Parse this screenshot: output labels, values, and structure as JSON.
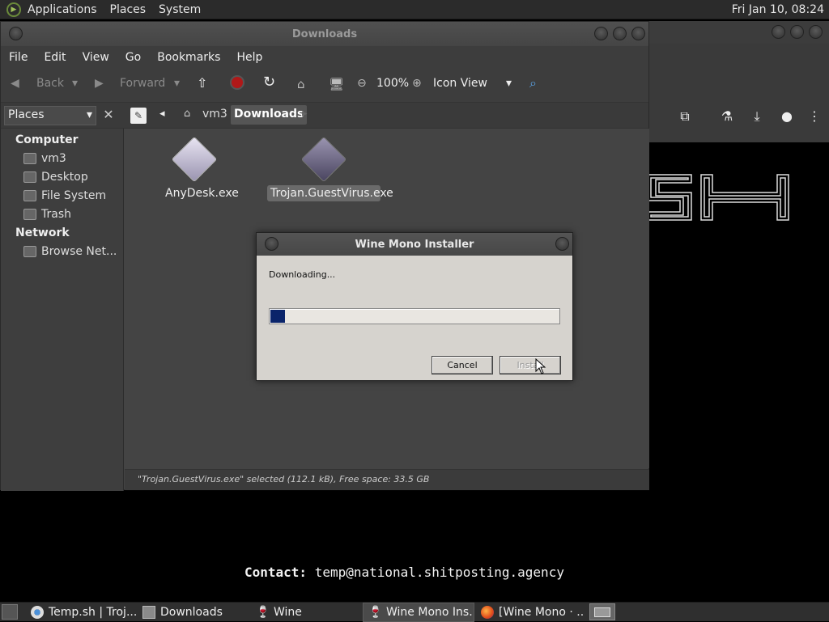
{
  "top_panel": {
    "menus": [
      "Applications",
      "Places",
      "System"
    ],
    "clock": "Fri Jan 10, 08:24"
  },
  "browser": {
    "contact_label": "Contact:",
    "contact_value": "temp@national.shitposting.agency"
  },
  "file_manager": {
    "title": "Downloads",
    "menu": [
      "File",
      "Edit",
      "View",
      "Go",
      "Bookmarks",
      "Help"
    ],
    "toolbar": {
      "back": "Back",
      "forward": "Forward",
      "zoom": "100%",
      "view_mode": "Icon View"
    },
    "location": {
      "crumbs": [
        "vm3",
        "Downloads"
      ]
    },
    "sidebar": {
      "combo": "Places",
      "sections": [
        {
          "title": "Computer",
          "items": [
            "vm3",
            "Desktop",
            "File System",
            "Trash"
          ]
        },
        {
          "title": "Network",
          "items": [
            "Browse Net..."
          ]
        }
      ]
    },
    "files": [
      {
        "name": "AnyDesk.exe",
        "selected": false
      },
      {
        "name": "Trojan.GuestVirus.exe",
        "selected": true
      }
    ],
    "status": "\"Trojan.GuestVirus.exe\" selected (112.1 kB), Free space: 33.5 GB"
  },
  "dialog": {
    "title": "Wine Mono Installer",
    "message": "Downloading...",
    "progress": 0.05,
    "cancel": "Cancel",
    "install": "Install"
  },
  "taskbar": {
    "tasks": [
      {
        "label": "Temp.sh | Troj..."
      },
      {
        "label": "Downloads"
      },
      {
        "label": "Wine"
      },
      {
        "label": "Wine Mono Ins..."
      },
      {
        "label": "[Wine Mono · ..."
      }
    ]
  },
  "colors": {
    "progress_fill": "#0a246a",
    "selection": "#6a6a6a"
  }
}
